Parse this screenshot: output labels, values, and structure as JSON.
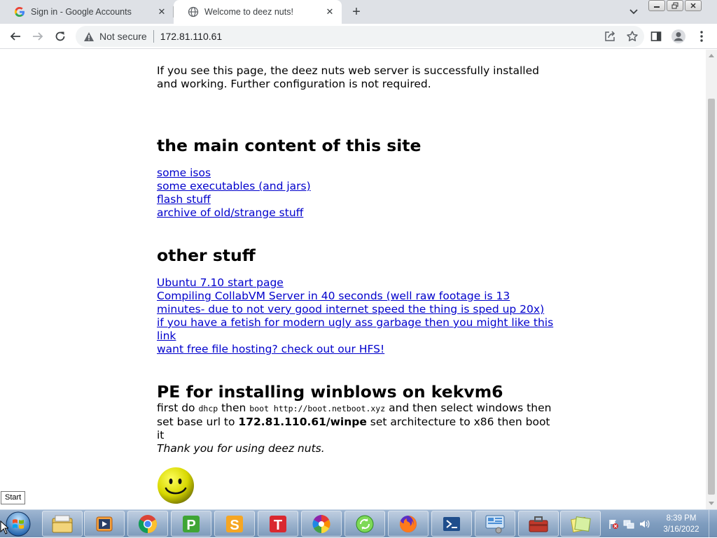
{
  "browser": {
    "tabs": [
      {
        "title": "Sign in - Google Accounts",
        "favicon": "google-icon",
        "active": false
      },
      {
        "title": "Welcome to deez nuts!",
        "favicon": "globe-icon",
        "active": true
      }
    ],
    "omnibox": {
      "security_label": "Not secure",
      "url": "172.81.110.61"
    }
  },
  "page": {
    "intro": "If you see this page, the deez nuts web server is successfully installed and working. Further configuration is not required.",
    "main_heading": "the main content of this site",
    "main_links": [
      "some isos",
      "some executables (and jars)",
      "flash stuff",
      "archive of old/strange stuff"
    ],
    "other_heading": "other stuff",
    "other_links": [
      "Ubuntu 7.10 start page",
      "Compiling CollabVM Server in 40 seconds (well raw footage is 13 minutes- due to not very good internet speed the thing is sped up 20x)",
      "if you have a fetish for modern ugly ass garbage then you might like this link",
      "want free file hosting? check out our HFS!"
    ],
    "pe_heading": "PE for installing winblows on kekvm6",
    "pe": {
      "t1": "first do ",
      "c1": "dhcp",
      "t2": " then ",
      "c2": "boot http://boot.netboot.xyz",
      "t3": " and then select windows then set base url to ",
      "b1": "172.81.110.61/winpe",
      "t4": " set architecture to x86 then boot it"
    },
    "thanks": "Thank you for using deez nuts."
  },
  "tooltip": "Start",
  "taskbar": {
    "items": [
      "file-explorer-icon",
      "media-player-icon",
      "chrome-icon",
      "p-app-icon",
      "s-app-icon",
      "t-app-icon",
      "pinwheel-app-icon",
      "refresh-globe-icon",
      "firefox-icon",
      "powershell-icon",
      "control-panel-icon",
      "toolbox-icon",
      "sticky-notes-icon"
    ],
    "clock": {
      "time": "8:39 PM",
      "date": "3/16/2022"
    }
  },
  "colors": {
    "link": "#0000cc",
    "taskbar": "#7f9dbf",
    "tabstrip": "#dee1e6"
  }
}
